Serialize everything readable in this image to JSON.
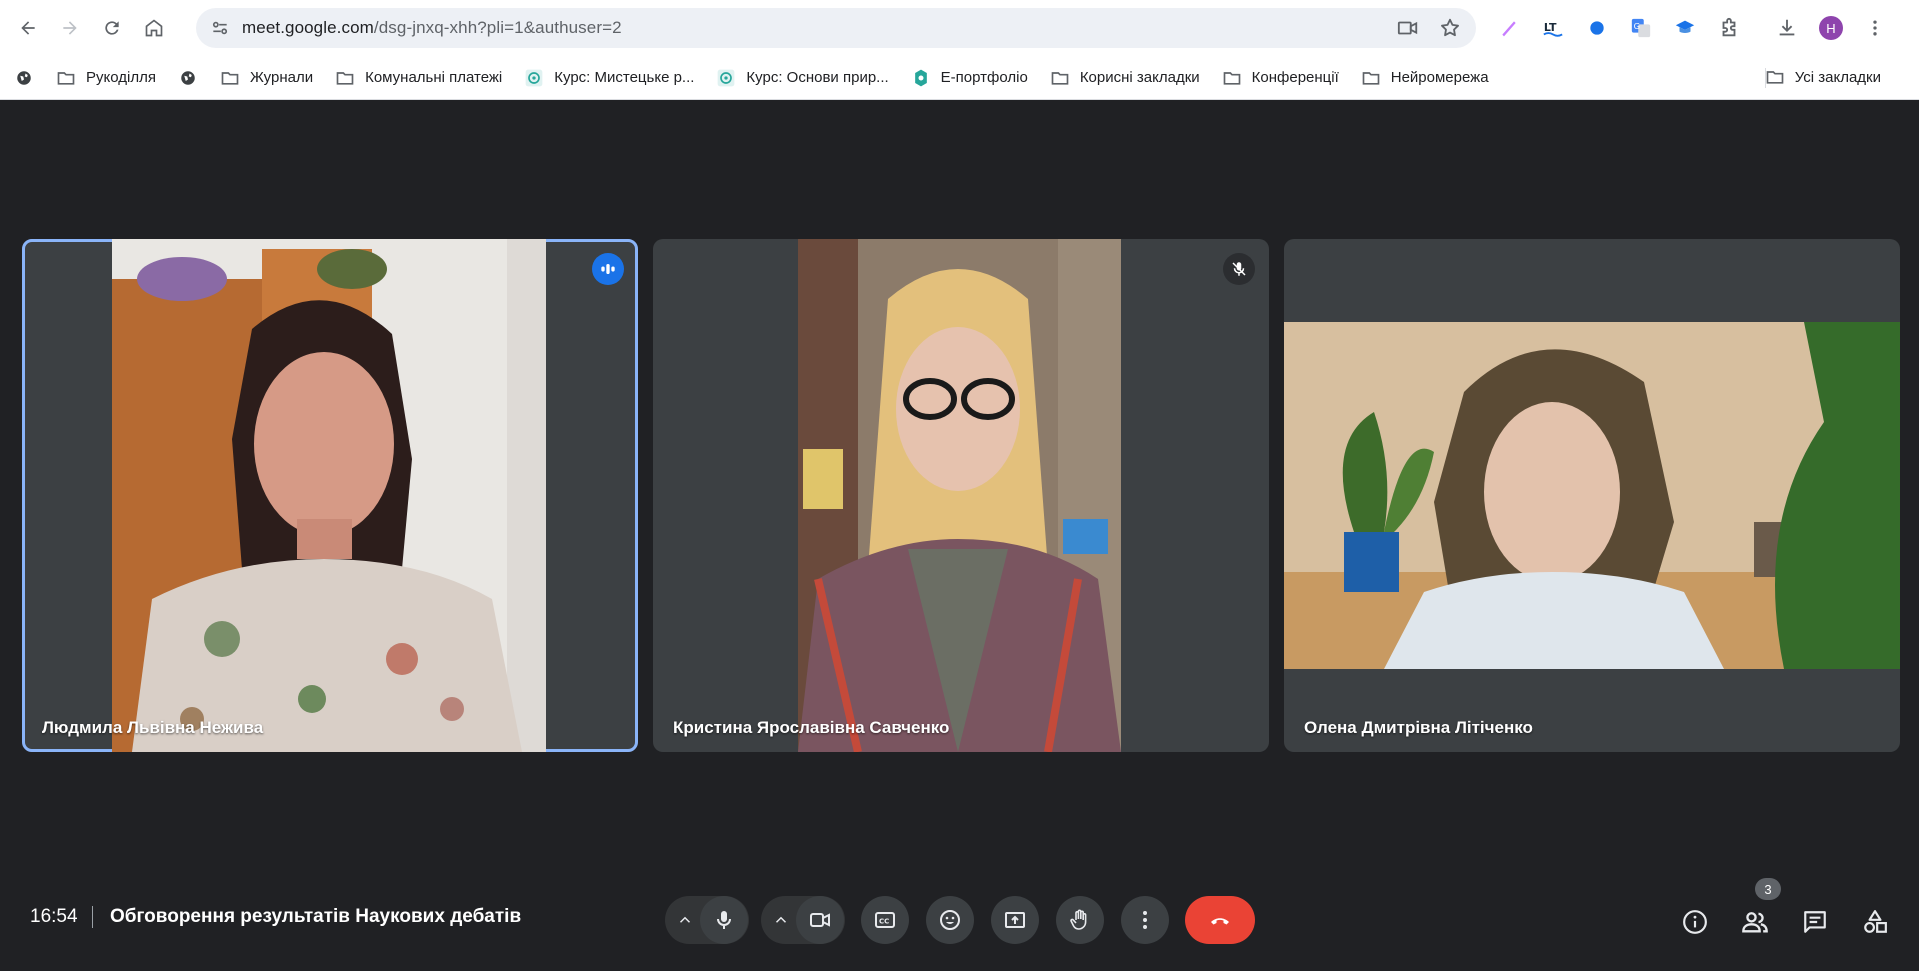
{
  "browser": {
    "url_host": "meet.google.com",
    "url_path": "/dsg-jnxq-xhh?pli=1&authuser=2",
    "profile_initial": "H"
  },
  "bookmarks": [
    {
      "label": "Рукоділля",
      "icon": "folder-icon"
    },
    {
      "label": "Журнали",
      "icon": "folder-icon"
    },
    {
      "label": "Комунальні платежі",
      "icon": "folder-icon"
    },
    {
      "label": "Курс: Мистецьке р...",
      "icon": "course-icon"
    },
    {
      "label": "Курс: Основи прир...",
      "icon": "course-icon"
    },
    {
      "label": "Е-портфоліо",
      "icon": "portfolio-icon"
    },
    {
      "label": "Корисні закладки",
      "icon": "folder-icon"
    },
    {
      "label": "Конференції",
      "icon": "folder-icon"
    },
    {
      "label": "Нейромережа",
      "icon": "folder-icon"
    }
  ],
  "all_bookmarks_label": "Усі закладки",
  "participants": [
    {
      "name": "Людмила Львівна Нежива",
      "status": "speaking"
    },
    {
      "name": "Кристина Ярославівна Савченко",
      "status": "muted"
    },
    {
      "name": "Олена Дмитрівна Літіченко",
      "status": "none"
    }
  ],
  "meeting": {
    "time": "16:54",
    "title": "Обговорення результатів Наукових дебатів",
    "participant_count": "3"
  },
  "colors": {
    "accent": "#1a73e8",
    "end_call": "#ea4335",
    "background": "#202124",
    "tile": "#3c4043",
    "active_outline": "#8ab4f8"
  }
}
